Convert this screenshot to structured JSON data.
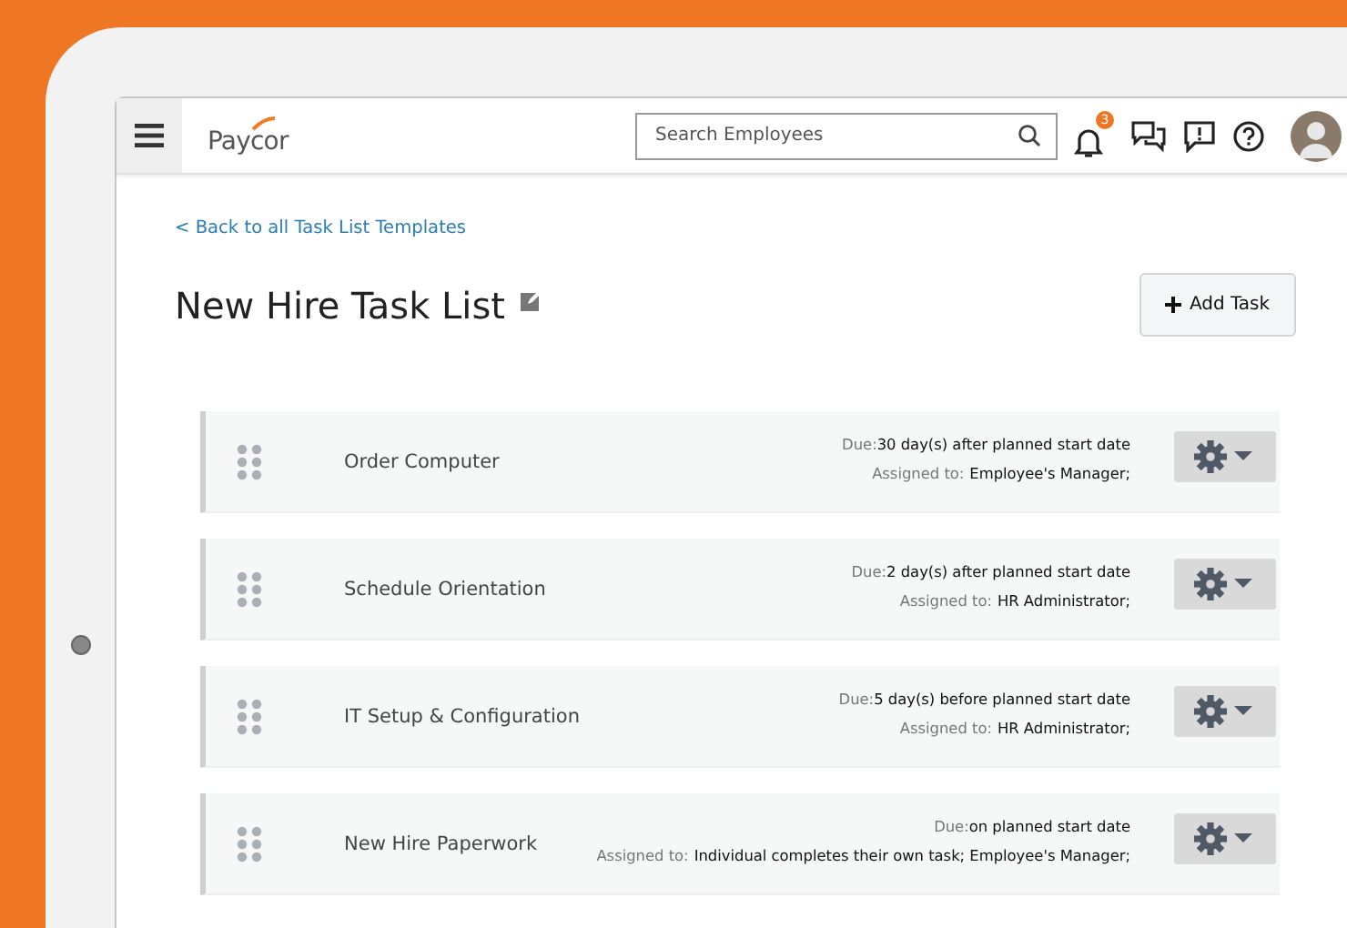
{
  "header": {
    "logo": "Paycor",
    "search": {
      "placeholder": "Search Employees"
    },
    "notification_count": "3"
  },
  "back_link": "< Back to all Task List Templates",
  "title": "New Hire Task List",
  "add_button": "Add Task",
  "tasks": [
    {
      "name": "Order Computer",
      "due_label": "Due:",
      "due": "30 day(s) after planned start date",
      "assigned_label": "Assigned to:",
      "assigned": "Employee's Manager;"
    },
    {
      "name": "Schedule Orientation",
      "due_label": "Due:",
      "due": "2 day(s) after planned start date",
      "assigned_label": "Assigned to:",
      "assigned": "HR Administrator;"
    },
    {
      "name": "IT Setup & Configuration",
      "due_label": "Due:",
      "due": "5 day(s) before planned start date",
      "assigned_label": "Assigned to:",
      "assigned": "HR Administrator;"
    },
    {
      "name": "New Hire Paperwork",
      "due_label": "Due:",
      "due": "on planned start date",
      "assigned_label": "Assigned to:",
      "assigned": "Individual completes their own task; Employee's Manager;"
    }
  ]
}
